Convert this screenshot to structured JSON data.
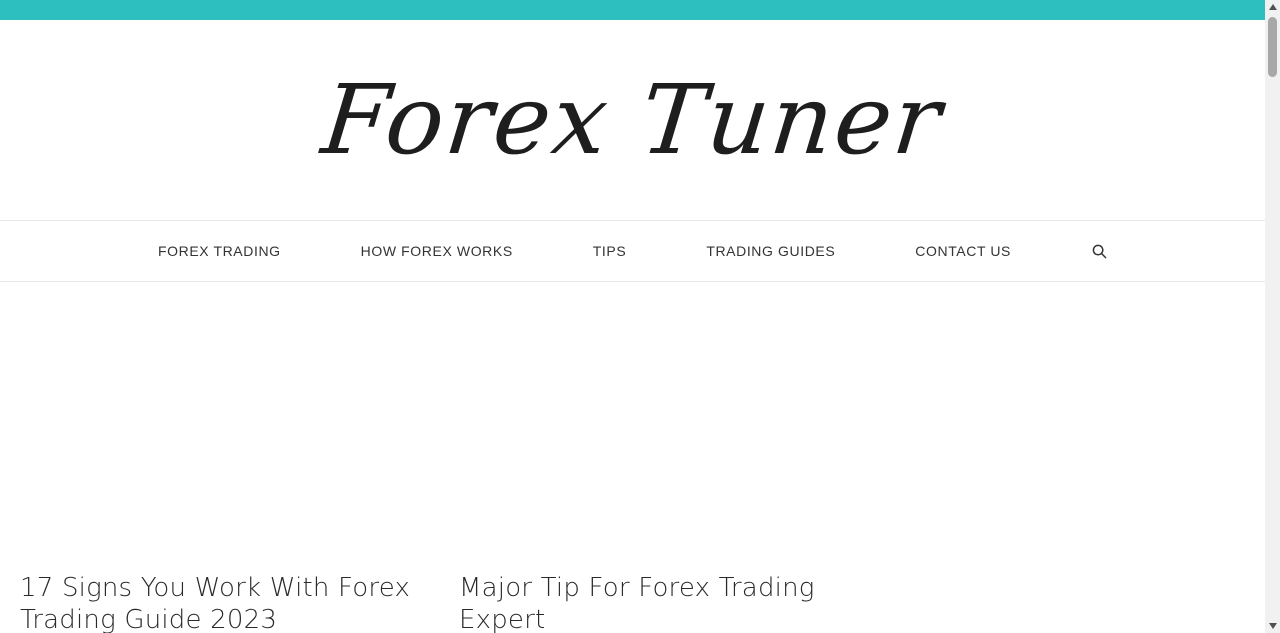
{
  "brand": {
    "accent_color": "#2dbfbf",
    "site_title": "Forex Tuner"
  },
  "nav": {
    "items": [
      {
        "label": "FOREX TRADING"
      },
      {
        "label": "HOW FOREX WORKS"
      },
      {
        "label": "TIPS"
      },
      {
        "label": "TRADING GUIDES"
      },
      {
        "label": "CONTACT US"
      }
    ],
    "search_icon": "search-icon"
  },
  "posts": [
    {
      "title": "17 Signs You Work With Forex Trading Guide 2023"
    },
    {
      "title": "Major Tip For Forex Trading Expert"
    }
  ]
}
